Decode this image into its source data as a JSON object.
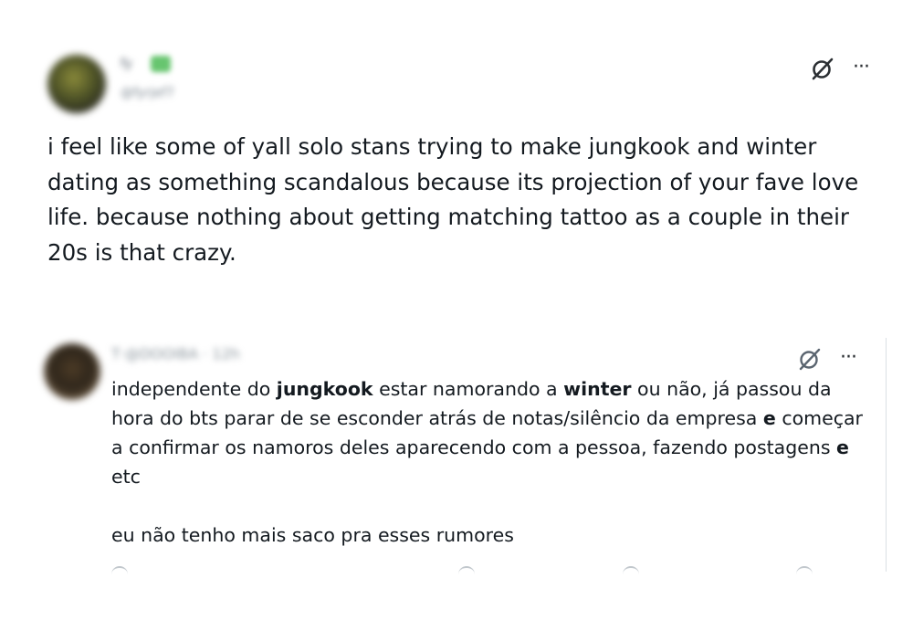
{
  "post1": {
    "author_name": "fy",
    "author_handle": "@fyrjef7",
    "text": "i feel like some of yall solo stans trying to make jungkook and winter dating as something scandalous because its projection of your fave love life. because nothing about getting matching tattoo as a couple in their 20s is that crazy.",
    "more_label": "···"
  },
  "post2": {
    "author_meta": "T·@DOOIBA · 12h",
    "text_parts": {
      "p1": "independente do ",
      "b1": "jungkook",
      "p2": " estar namorando a ",
      "b2": "winter",
      "p3": " ou não, já passou da hora do bts parar de se esconder atrás de notas/silêncio da empresa ",
      "b3": "e",
      "p4": " começar a confirmar os namoros deles aparecendo com a pessoa, fazendo postagens ",
      "b4": "e",
      "p5": " etc"
    },
    "text2": "eu não tenho mais saco pra esses rumores",
    "more_label": "···"
  },
  "icons": {
    "grok": "grok-icon",
    "more": "more-options-icon",
    "verified": "verified-badge-icon"
  },
  "colors": {
    "text": "#0f1419",
    "muted": "#536471",
    "border": "#dbe0e4"
  }
}
